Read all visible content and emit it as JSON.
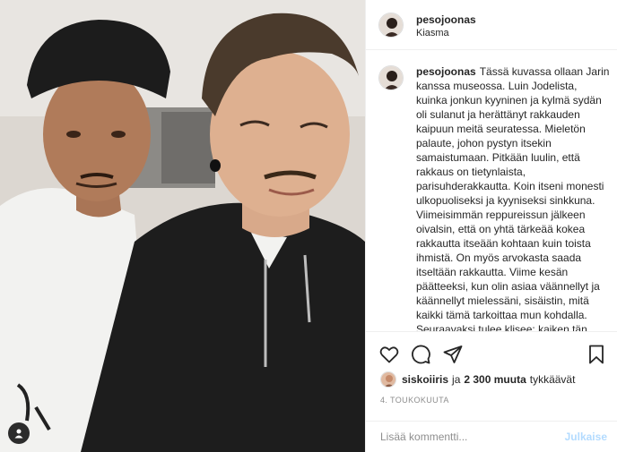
{
  "post": {
    "username": "pesojoonas",
    "location": "Kiasma",
    "caption_username": "pesojoonas",
    "caption_text": "Tässä kuvassa ollaan Jarin kanssa museossa. Luin Jodelista, kuinka jonkun kyyninen ja kylmä sydän oli sulanut ja herättänyt rakkauden kaipuun meitä seuratessa. Mieletön palaute, johon pystyn itsekin samaistumaan. Pitkään luulin, että rakkaus on tietynlaista, parisuhderakkautta. Koin itseni monesti ulkopuoliseksi ja kyyniseksi sinkkuna. Viimeisimmän reppureissun jälkeen oivalsin, että on yhtä tärkeää kokea rakkautta itseään kohtaan kuin toista ihmistä. On myös arvokasta saada itseltään rakkautta. Viime kesän päätteeksi, kun olin asiaa väännellyt ja käännellyt mielessäni, sisäistin, mitä kaikki tämä tarkoittaa mun kohdalla. Seuraavaksi tulee klisee: kaiken tän jälkeen ja perin sattuman ja"
  },
  "likes": {
    "liker": "siskoiiris",
    "connector": "ja",
    "count": "2 300 muuta",
    "suffix": "tykkäävät"
  },
  "date": "4. TOUKOKUUTA",
  "comment": {
    "placeholder": "Lisää kommentti...",
    "post_label": "Julkaise"
  },
  "icons": {
    "like": "heart-icon",
    "comment": "comment-bubble-icon",
    "share": "paper-plane-icon",
    "save": "bookmark-icon",
    "tags": "person-tag-icon"
  },
  "colors": {
    "text": "#262626",
    "muted": "#8e8e8e",
    "link_disabled": "#b3dbff",
    "divider": "#efefef"
  }
}
